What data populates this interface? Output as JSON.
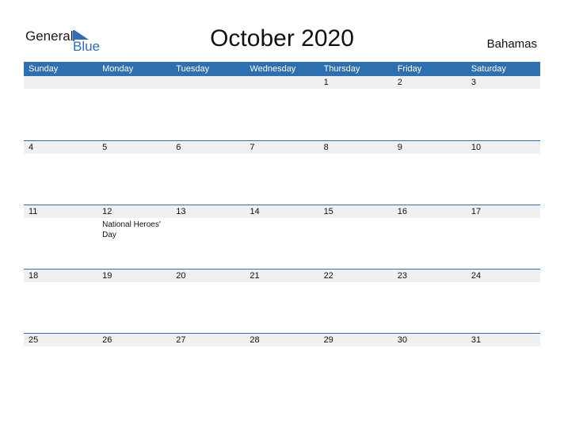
{
  "logo": {
    "line1": "General",
    "line2": "Blue"
  },
  "title": "October 2020",
  "country": "Bahamas",
  "weekdays": [
    "Sunday",
    "Monday",
    "Tuesday",
    "Wednesday",
    "Thursday",
    "Friday",
    "Saturday"
  ],
  "weeks": [
    [
      {
        "d": ""
      },
      {
        "d": ""
      },
      {
        "d": ""
      },
      {
        "d": ""
      },
      {
        "d": "1"
      },
      {
        "d": "2"
      },
      {
        "d": "3"
      }
    ],
    [
      {
        "d": "4"
      },
      {
        "d": "5"
      },
      {
        "d": "6"
      },
      {
        "d": "7"
      },
      {
        "d": "8"
      },
      {
        "d": "9"
      },
      {
        "d": "10"
      }
    ],
    [
      {
        "d": "11"
      },
      {
        "d": "12",
        "e": "National Heroes' Day"
      },
      {
        "d": "13"
      },
      {
        "d": "14"
      },
      {
        "d": "15"
      },
      {
        "d": "16"
      },
      {
        "d": "17"
      }
    ],
    [
      {
        "d": "18"
      },
      {
        "d": "19"
      },
      {
        "d": "20"
      },
      {
        "d": "21"
      },
      {
        "d": "22"
      },
      {
        "d": "23"
      },
      {
        "d": "24"
      }
    ],
    [
      {
        "d": "25"
      },
      {
        "d": "26"
      },
      {
        "d": "27"
      },
      {
        "d": "28"
      },
      {
        "d": "29"
      },
      {
        "d": "30"
      },
      {
        "d": "31"
      }
    ]
  ]
}
